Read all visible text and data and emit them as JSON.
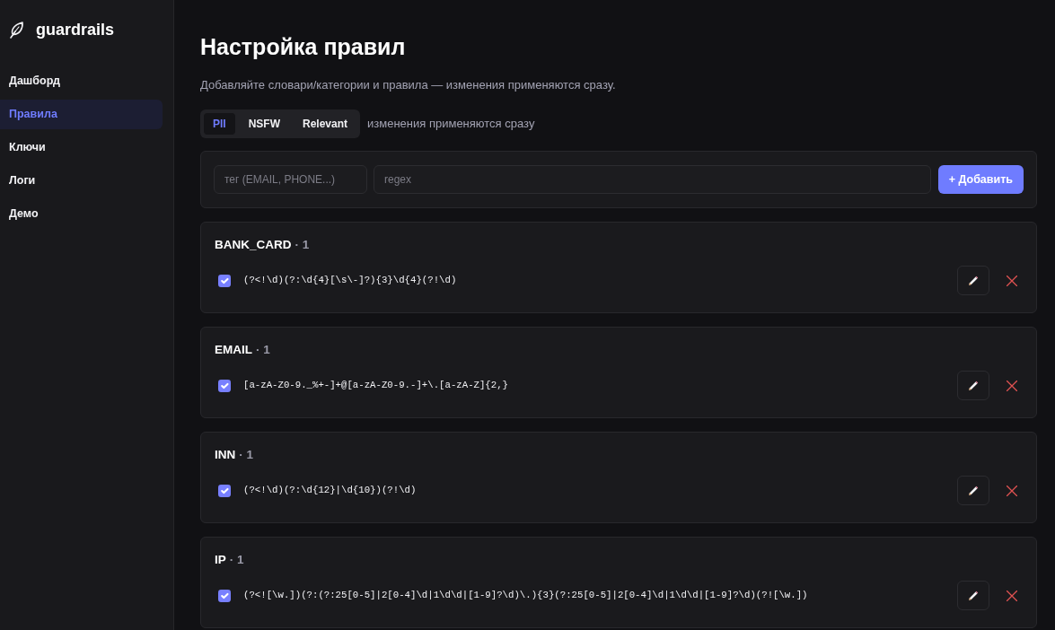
{
  "sidebar": {
    "brand": "guardrails",
    "items": [
      {
        "label": "Дашборд",
        "selected": false
      },
      {
        "label": "Правила",
        "selected": true
      },
      {
        "label": "Ключи",
        "selected": false
      },
      {
        "label": "Логи",
        "selected": false
      },
      {
        "label": "Демо",
        "selected": false
      }
    ]
  },
  "page": {
    "title": "Настройка правил",
    "subtitle": "Добавляйте словари/категории и правила — изменения применяются сразу."
  },
  "tabs": [
    {
      "label": "PII",
      "selected": true
    },
    {
      "label": "NSFW",
      "selected": false
    },
    {
      "label": "Relevant",
      "selected": false
    }
  ],
  "tabs_note": "изменения применяются сразу",
  "add_form": {
    "tag_field": {
      "placeholder": "тег (EMAIL, PHONE...)"
    },
    "regex_field": {
      "placeholder": "regex"
    },
    "button": "+ Добавить"
  },
  "groups": [
    {
      "tag": "BANK_CARD",
      "count": "· 1",
      "rules": [
        {
          "pattern": "(?<!\\d)(?:\\d{4}[\\s\\-]?){3}\\d{4}(?!\\d)",
          "checked": true
        }
      ]
    },
    {
      "tag": "EMAIL",
      "count": "· 1",
      "rules": [
        {
          "pattern": "[a-zA-Z0-9._%+-]+@[a-zA-Z0-9.-]+\\.[a-zA-Z]{2,}",
          "checked": true
        }
      ]
    },
    {
      "tag": "INN",
      "count": "· 1",
      "rules": [
        {
          "pattern": "(?<!\\d)(?:\\d{12}|\\d{10})(?!\\d)",
          "checked": true
        }
      ]
    },
    {
      "tag": "IP",
      "count": "· 1",
      "rules": [
        {
          "pattern": "(?<![\\w.])(?:(?:25[0-5]|2[0-4]\\d|1\\d\\d|[1-9]?\\d)\\.){3}(?:25[0-5]|2[0-4]\\d|1\\d\\d|[1-9]?\\d)(?![\\w.])",
          "checked": true
        }
      ]
    }
  ]
}
